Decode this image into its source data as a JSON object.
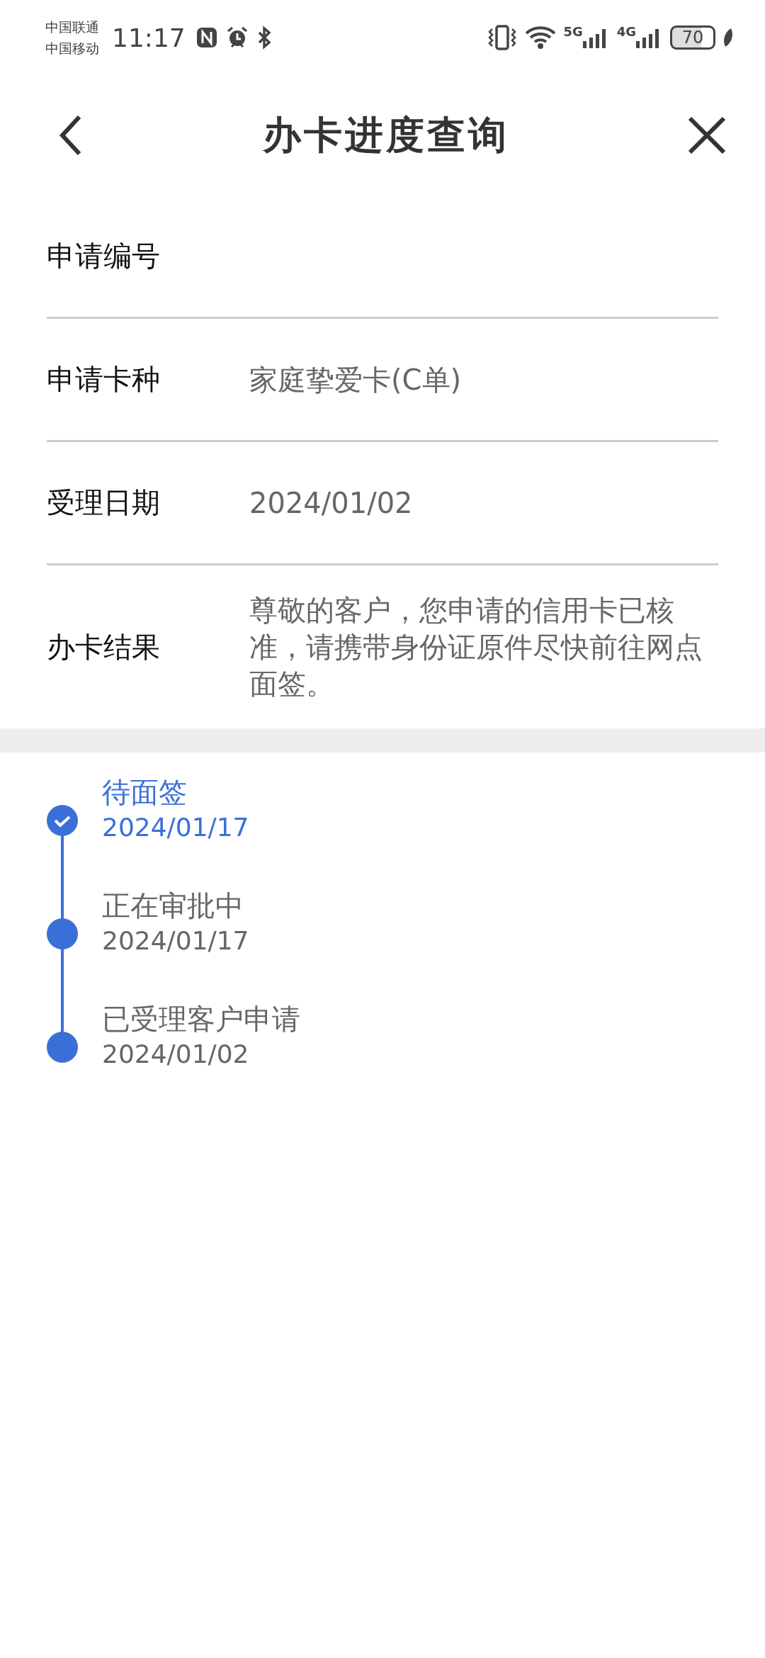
{
  "status_bar": {
    "carriers": [
      "中国联通",
      "中国移动"
    ],
    "time": "11:17",
    "network_labels": [
      "5G",
      "4G"
    ],
    "battery": "70"
  },
  "header": {
    "title": "办卡进度查询"
  },
  "fields": [
    {
      "label": "申请编号"
    },
    {
      "label": "申请卡种",
      "value": "家庭挚爱卡(C单)"
    },
    {
      "label": "受理日期",
      "value": "2024/01/02"
    },
    {
      "label": "办卡结果",
      "value": "尊敬的客户，您申请的信用卡已核准，请携带身份证原件尽快前往网点面签。"
    }
  ],
  "timeline": [
    {
      "title": "待面签",
      "date": "2024/01/17",
      "selected": true
    },
    {
      "title": "正在审批中",
      "date": "2024/01/17",
      "selected": false
    },
    {
      "title": "已受理客户申请",
      "date": "2024/01/02",
      "selected": false
    }
  ]
}
